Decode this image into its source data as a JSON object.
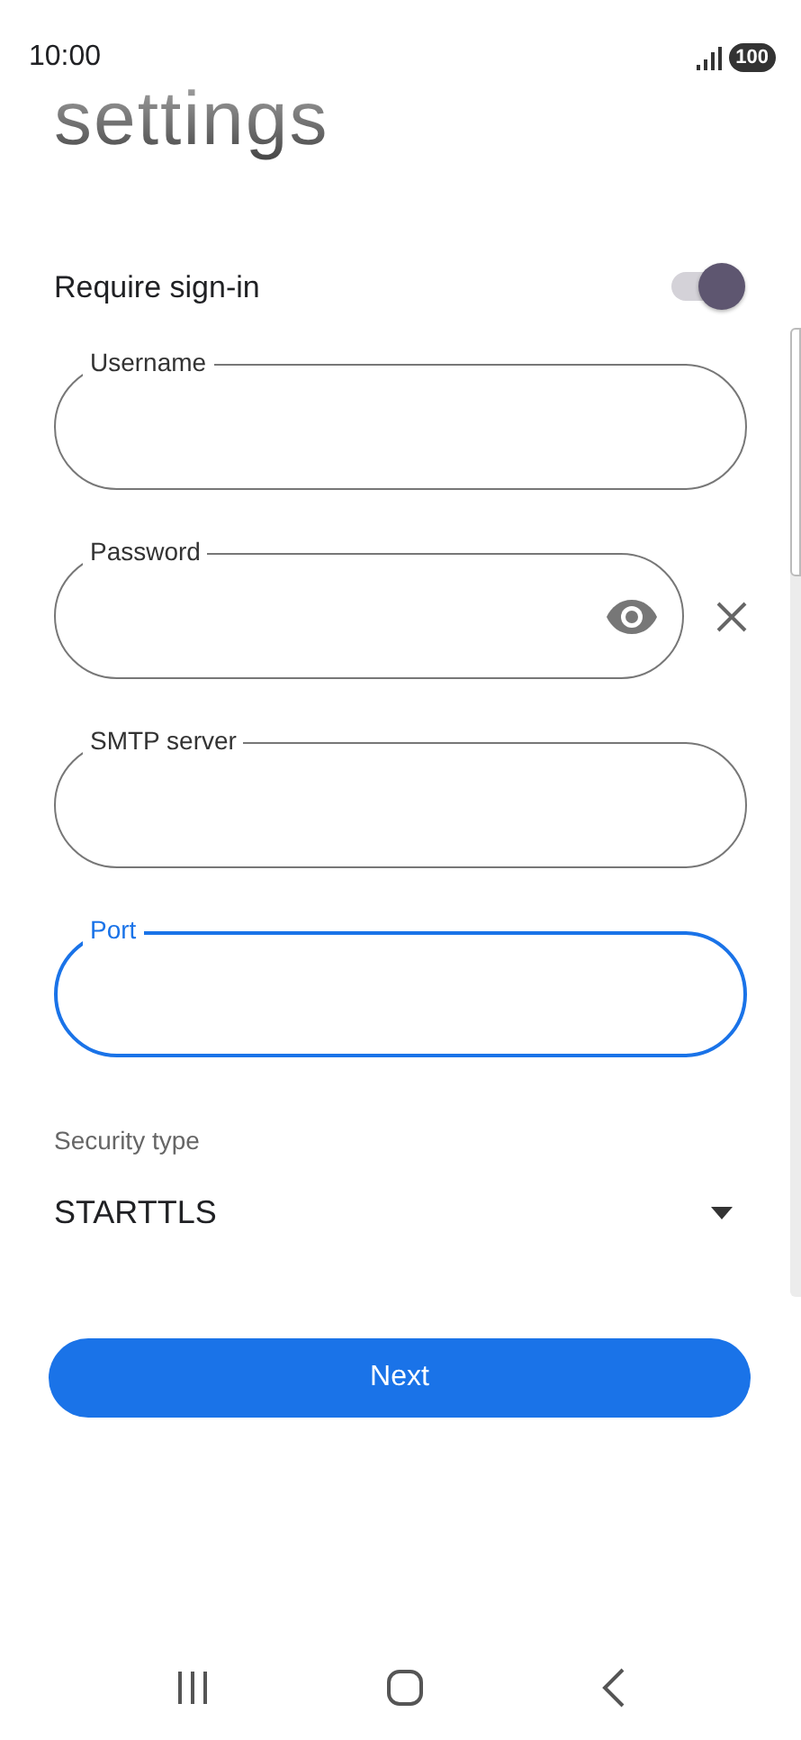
{
  "status_bar": {
    "time": "10:00",
    "battery": "100"
  },
  "title": "settings",
  "require_sign_in": {
    "label": "Require sign-in",
    "on": true
  },
  "fields": [
    {
      "label": "Username",
      "kind": "text",
      "focused": false
    },
    {
      "label": "Password",
      "kind": "password",
      "focused": false
    },
    {
      "label": "SMTP server",
      "kind": "text",
      "focused": false
    },
    {
      "label": "Port",
      "kind": "text",
      "focused": true
    }
  ],
  "security_type": {
    "label": "Security type",
    "value": "STARTTLS"
  },
  "next_button": "Next"
}
